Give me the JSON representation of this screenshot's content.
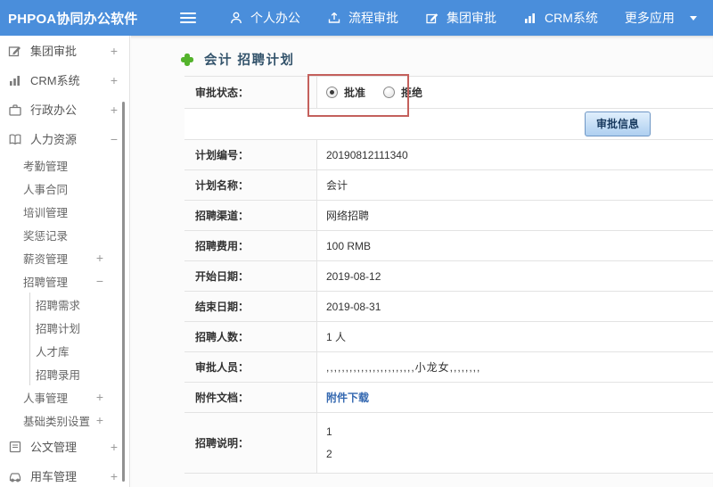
{
  "colors": {
    "topbar_bg": "#4a8edb",
    "title_color": "#33536b",
    "highlight_red": "#c4605c",
    "link_blue": "#3468b0",
    "plus_green": "#54b32c",
    "button_face": "#aecff0"
  },
  "topbar": {
    "brand": "PHPOA协同办公软件",
    "menu": [
      {
        "label": "个人办公",
        "icon": "person-icon"
      },
      {
        "label": "流程审批",
        "icon": "upload-icon"
      },
      {
        "label": "集团审批",
        "icon": "edit-icon"
      },
      {
        "label": "CRM系统",
        "icon": "bar-chart-icon"
      },
      {
        "label": "更多应用",
        "icon": "caret-down-icon"
      }
    ]
  },
  "sidebar": {
    "items": [
      {
        "label": "集团审批",
        "expand": "+",
        "icon": "edit-square-icon",
        "level": 1
      },
      {
        "label": "CRM系统",
        "expand": "+",
        "icon": "bar-chart-icon",
        "level": 1
      },
      {
        "label": "行政办公",
        "expand": "+",
        "icon": "briefcase-icon",
        "level": 1
      },
      {
        "label": "人力资源",
        "expand": "−",
        "icon": "book-icon",
        "level": 1
      },
      {
        "label": "考勤管理",
        "level": 2
      },
      {
        "label": "人事合同",
        "level": 2
      },
      {
        "label": "培训管理",
        "level": 2
      },
      {
        "label": "奖惩记录",
        "level": 2
      },
      {
        "label": "薪资管理",
        "expand": "+",
        "level": 2
      },
      {
        "label": "招聘管理",
        "expand": "−",
        "level": 2
      },
      {
        "label": "招聘需求",
        "level": 3
      },
      {
        "label": "招聘计划",
        "level": 3
      },
      {
        "label": "人才库",
        "level": 3
      },
      {
        "label": "招聘录用",
        "level": 3
      },
      {
        "label": "人事管理",
        "expand": "+",
        "level": 2
      },
      {
        "label": "基础类别设置",
        "expand": "+",
        "level": 2
      },
      {
        "label": "公文管理",
        "expand": "+",
        "icon": "document-icon",
        "level": 1
      },
      {
        "label": "用车管理",
        "expand": "+",
        "icon": "car-icon",
        "level": 1
      }
    ]
  },
  "main": {
    "page_title": "会计 招聘计划",
    "approval": {
      "label": "审批状态：",
      "options": [
        {
          "label": "批准",
          "checked": true
        },
        {
          "label": "拒绝",
          "checked": false
        }
      ]
    },
    "approve_button": "审批信息",
    "rows": [
      {
        "label": "计划编号：",
        "value": "20190812111340"
      },
      {
        "label": "计划名称：",
        "value": "会计"
      },
      {
        "label": "招聘渠道：",
        "value": "网络招聘"
      },
      {
        "label": "招聘费用：",
        "value": "100 RMB"
      },
      {
        "label": "开始日期：",
        "value": "2019-08-12"
      },
      {
        "label": "结束日期：",
        "value": "2019-08-31"
      },
      {
        "label": "招聘人数：",
        "value": "1 人"
      },
      {
        "label": "审批人员：",
        "value": ",,,,,,,,,,,,,,,,,,,,,,,小龙女,,,,,,,,"
      },
      {
        "label": "附件文档：",
        "value": "附件下载",
        "type": "link"
      },
      {
        "label": "招聘说明：",
        "lines": [
          "1",
          "2"
        ]
      }
    ]
  }
}
